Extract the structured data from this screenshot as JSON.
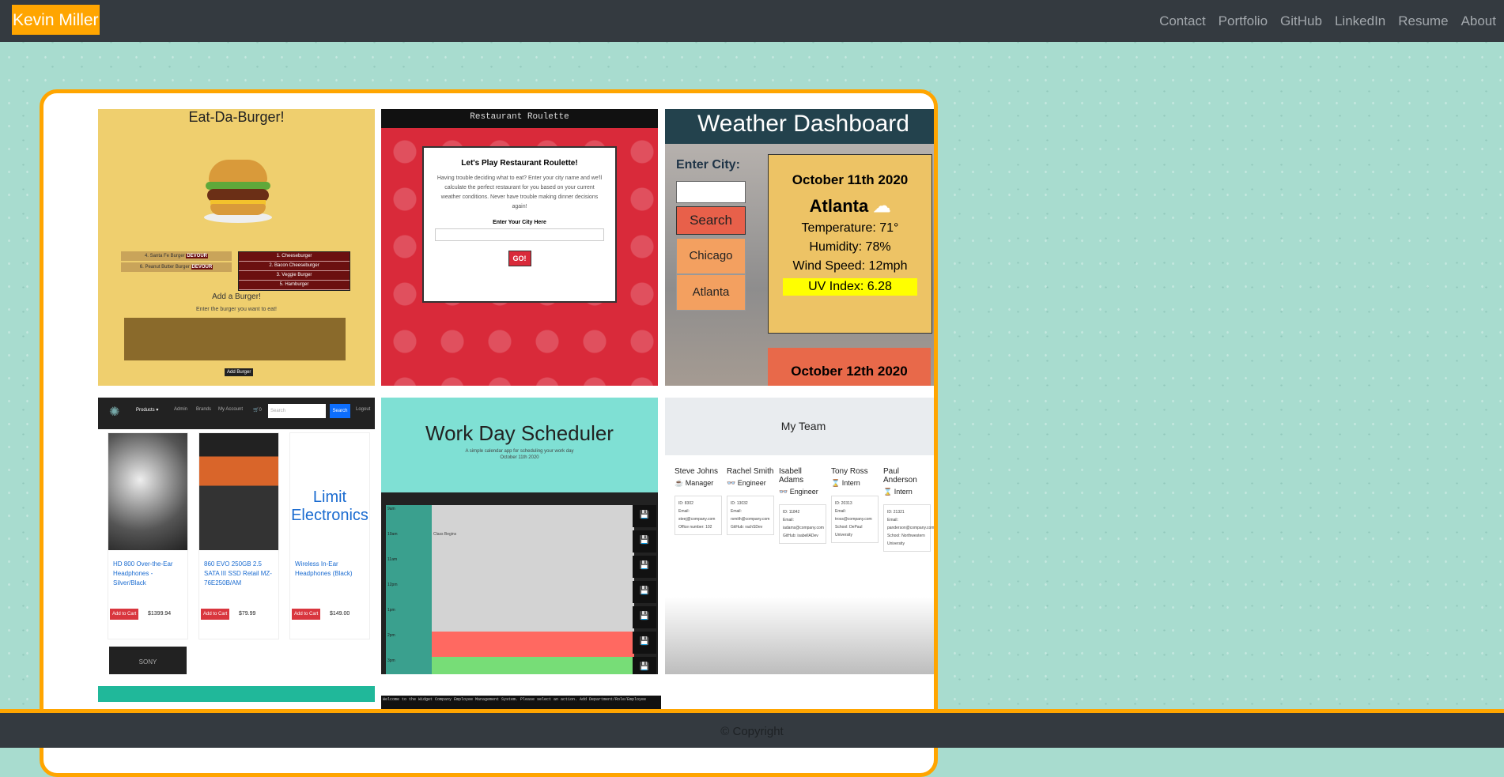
{
  "brand": "Kevin Miller",
  "nav": [
    "Contact",
    "Portfolio",
    "GitHub",
    "LinkedIn",
    "Resume",
    "About"
  ],
  "burger": {
    "title": "Eat-Da-Burger!",
    "uneaten": [
      "4. Santa Fe Burger",
      "6. Peanut Butter Burger"
    ],
    "devour_label": "DEVOUR",
    "devoured": [
      "1. Cheeseburger",
      "2. Bacon Cheeseburger",
      "3. Veggie Burger",
      "5. Hamburger"
    ],
    "add_title": "Add a Burger!",
    "add_sub": "Enter the burger you want to eat!",
    "add_button": "Add Burger"
  },
  "roulette": {
    "bar_title": "Restaurant Roulette",
    "heading": "Let's Play Restaurant Roulette!",
    "text": "Having trouble deciding what to eat? Enter your city name and we'll calculate the perfect restaurant for you based on your current weather conditions. Never have trouble making dinner decisions again!",
    "input_label": "Enter Your City Here",
    "go": "GO!"
  },
  "weather": {
    "title": "Weather Dashboard",
    "enter_city": "Enter City:",
    "search": "Search",
    "cities": [
      "Chicago",
      "Atlanta"
    ],
    "date": "October 11th 2020",
    "city": "Atlanta",
    "temperature": "Temperature: 71°",
    "humidity": "Humidity: 78%",
    "wind": "Wind Speed: 12mph",
    "uv": "UV Index: 6.28",
    "next_date": "October 12th 2020"
  },
  "shop": {
    "menu": [
      "Products ▾",
      "Admin",
      "Brands",
      "My Account",
      "🛒0"
    ],
    "search_placeholder": "Search",
    "search_button": "Search",
    "logout": "Logout",
    "products": [
      {
        "name": "HD 800 Over-the-Ear Headphones - Silver/Black",
        "price": "$1399.94"
      },
      {
        "name": "860 EVO 250GB 2.5 SATA III SSD Retail MZ-76E250B/AM",
        "price": "$79.99"
      },
      {
        "name": "Wireless In-Ear Headphones (Black)",
        "price": "$149.00"
      }
    ],
    "add_to_cart": "Add to Cart",
    "logo_text": "Limit Electronics",
    "brand_label": "SONY"
  },
  "scheduler": {
    "title": "Work Day Scheduler",
    "subtitle": "A simple calendar app for scheduling your work day",
    "date": "October 11th 2020",
    "hours": [
      "9am",
      "10am",
      "11am",
      "12pm",
      "1pm",
      "2pm",
      "3pm"
    ],
    "entries": [
      "",
      "Class Begins",
      "",
      "",
      "",
      "",
      ""
    ]
  },
  "team": {
    "title": "My Team",
    "members": [
      {
        "name": "Steve Johns",
        "role": "Manager",
        "id": "ID: 8302",
        "email": "Email: steej@company.com",
        "extra": "Office number: 102"
      },
      {
        "name": "Rachel Smith",
        "role": "Engineer",
        "id": "ID: 13032",
        "email": "Email: rsmith@company.com",
        "extra": "GitHub: rachSDev"
      },
      {
        "name": "Isabell Adams",
        "role": "Engineer",
        "id": "ID: 11842",
        "email": "Email: iadams@company.com",
        "extra": "GitHub: isabellADev"
      },
      {
        "name": "Tony Ross",
        "role": "Intern",
        "id": "ID: 20313",
        "email": "Email: tross@company.com",
        "extra": "School: DePaul University"
      },
      {
        "name": "Paul Anderson",
        "role": "Intern",
        "id": "ID: 21321",
        "email": "Email: panderson@company.com",
        "extra": "School: Northwestern University"
      }
    ]
  },
  "cli_text": "Welcome to the Widget Company Employee Management System. Please select an action. Add Department/Role/Employee",
  "footer": "© Copyright",
  "colors": {
    "accent": "#ffa500",
    "navbar": "#343a40",
    "background": "#a8dccf"
  }
}
